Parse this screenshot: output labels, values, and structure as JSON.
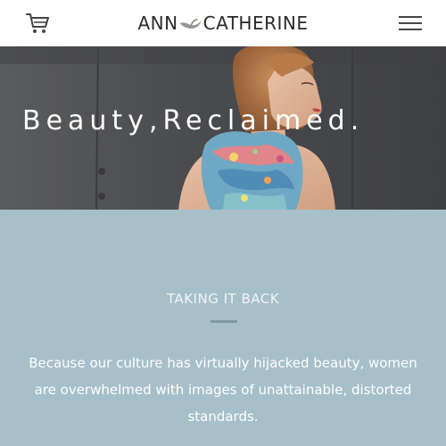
{
  "header": {
    "cart_icon": "shopping-cart-icon",
    "menu_icon": "hamburger-menu-icon",
    "logo": {
      "part1": "Ann",
      "part2": "Catherine",
      "mark_icon": "bird-icon"
    }
  },
  "hero": {
    "title": "Beauty,Reclaimed."
  },
  "about": {
    "heading": "TAKING IT BACK",
    "body": "Because our culture has virtually hijacked beauty, women are overwhelmed with images of unattainable, distorted standards."
  },
  "colors": {
    "about_background": "#a7bfc8",
    "divider": "#7f9aa4",
    "hero_background": "#4a4b4d"
  }
}
